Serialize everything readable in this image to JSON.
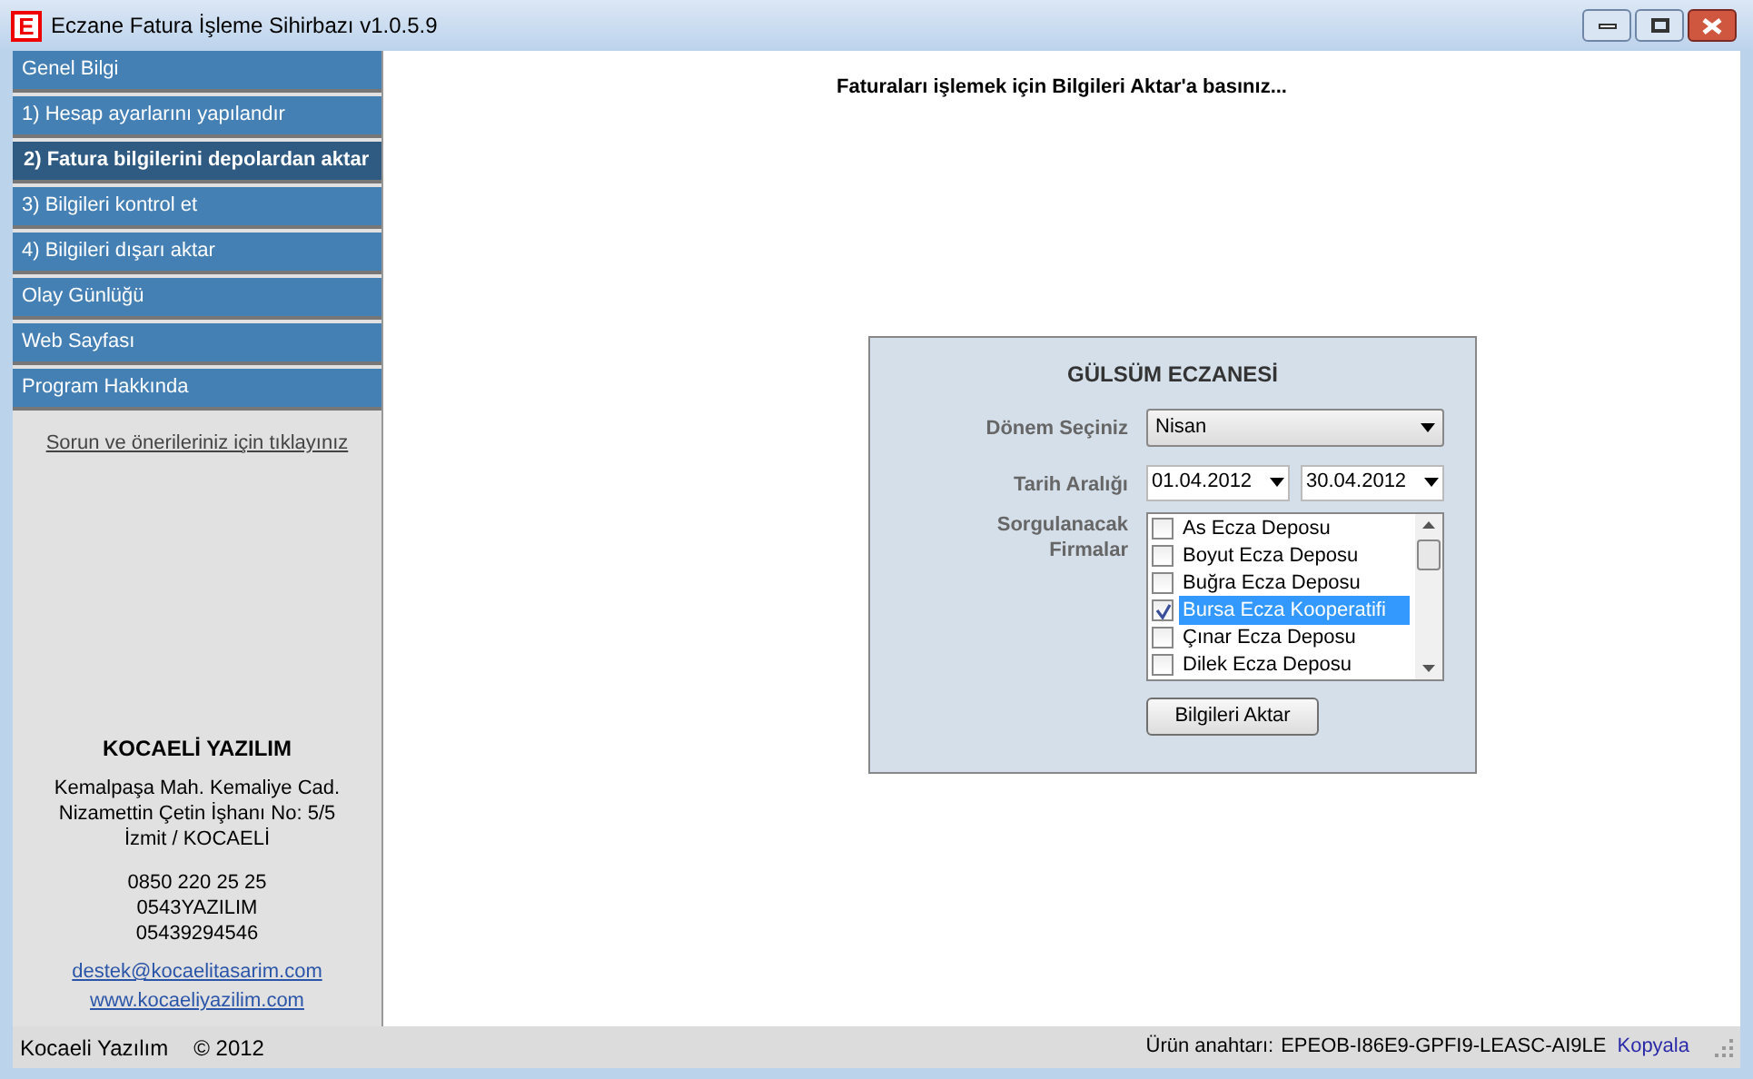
{
  "window": {
    "title": "Eczane Fatura İşleme Sihirbazı v1.0.5.9",
    "logo": "E"
  },
  "sidebar": {
    "items": [
      {
        "label": "Genel Bilgi",
        "selected": false
      },
      {
        "label": "1) Hesap ayarlarını yapılandır",
        "selected": false
      },
      {
        "label": "2) Fatura bilgilerini depolardan aktar",
        "selected": true
      },
      {
        "label": "3) Bilgileri kontrol et",
        "selected": false
      },
      {
        "label": "4) Bilgileri dışarı aktar",
        "selected": false
      },
      {
        "label": "Olay Günlüğü",
        "selected": false
      },
      {
        "label": "Web Sayfası",
        "selected": false
      },
      {
        "label": "Program Hakkında",
        "selected": false
      }
    ],
    "feedback_link": "Sorun ve önerileriniz için tıklayınız",
    "company": {
      "name": "KOCAELİ YAZILIM",
      "address": [
        "Kemalpaşa Mah. Kemaliye Cad.",
        "Nizamettin Çetin İşhanı No: 5/5",
        "İzmit / KOCAELİ"
      ],
      "phones": [
        "0850 220 25 25",
        "0543YAZILIM",
        "05439294546"
      ],
      "links": [
        "destek@kocaelitasarim.com",
        "www.kocaeliyazilim.com"
      ]
    }
  },
  "instruction": "Faturaları işlemek için Bilgileri Aktar'a basınız...",
  "panel": {
    "title": "GÜLSÜM ECZANESİ",
    "period_label": "Dönem Seçiniz",
    "period_value": "Nisan",
    "date_label": "Tarih Aralığı",
    "date_from": "01.04.2012",
    "date_to": "30.04.2012",
    "firms_label": "Sorgulanacak Firmalar",
    "firms": [
      {
        "label": "As Ecza Deposu",
        "checked": false,
        "selected": false
      },
      {
        "label": "Boyut Ecza Deposu",
        "checked": false,
        "selected": false
      },
      {
        "label": "Buğra Ecza Deposu",
        "checked": false,
        "selected": false
      },
      {
        "label": "Bursa Ecza Kooperatifi",
        "checked": true,
        "selected": true
      },
      {
        "label": "Çınar Ecza Deposu",
        "checked": false,
        "selected": false
      },
      {
        "label": "Dilek Ecza Deposu",
        "checked": false,
        "selected": false
      }
    ],
    "button": "Bilgileri Aktar"
  },
  "status_bar": {
    "left": "Kocaeli Yazılım",
    "copyright": "© 2012",
    "key_label": "Ürün anahtarı:",
    "key": "EPEOB-I86E9-GPFI9-LEASC-AI9LE",
    "copy_link": "Kopyala"
  }
}
